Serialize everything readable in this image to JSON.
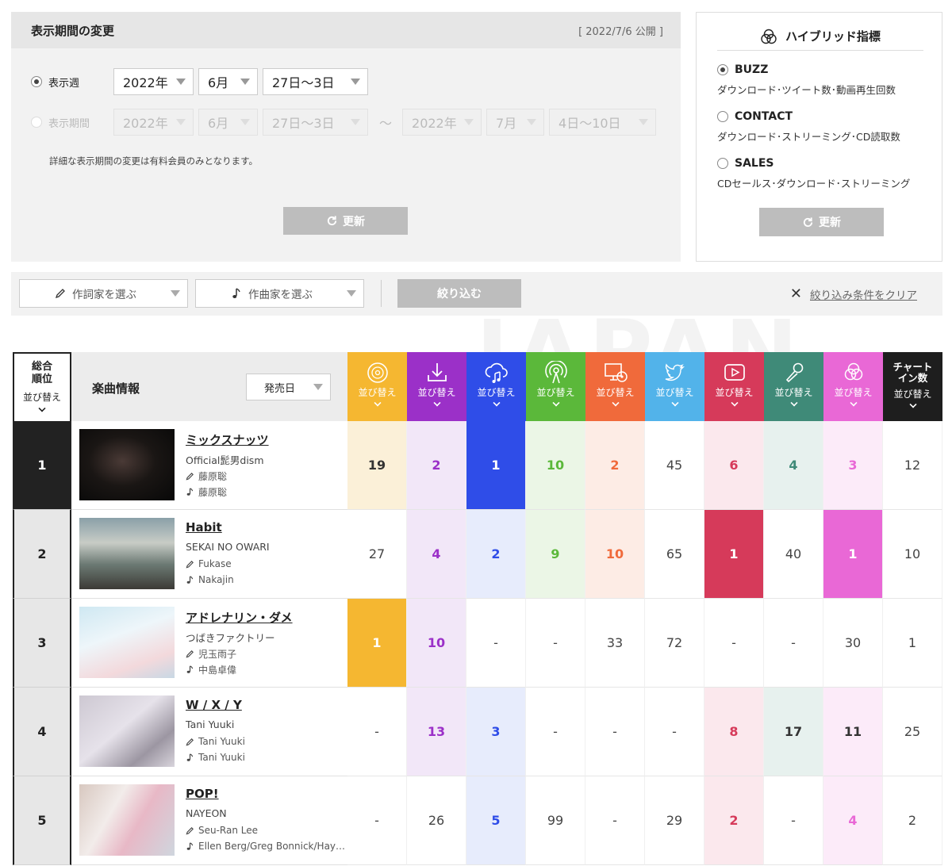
{
  "period": {
    "title": "表示期間の変更",
    "published": "[ 2022/7/6 公開 ]",
    "week_label": "表示週",
    "range_label": "表示期間",
    "week": {
      "year": "2022年",
      "month": "6月",
      "days": "27日〜3日"
    },
    "range_from": {
      "year": "2022年",
      "month": "6月",
      "days": "27日〜3日"
    },
    "range_sep": "〜",
    "range_to": {
      "year": "2022年",
      "month": "7月",
      "days": "4日〜10日"
    },
    "note": "詳細な表示期間の変更は有料会員のみとなります。",
    "update_label": "更新"
  },
  "hybrid": {
    "title": "ハイブリッド指標",
    "options": [
      {
        "name": "BUZZ",
        "desc": "ダウンロード･ツイート数･動画再生回数",
        "selected": true
      },
      {
        "name": "CONTACT",
        "desc": "ダウンロード･ストリーミング･CD読取数",
        "selected": false
      },
      {
        "name": "SALES",
        "desc": "CDセールス･ダウンロード･ストリーミング",
        "selected": false
      }
    ],
    "update_label": "更新"
  },
  "filter": {
    "lyricist_placeholder": "作詞家を選ぶ",
    "composer_placeholder": "作曲家を選ぶ",
    "narrow_label": "絞り込む",
    "clear_label": "絞り込み条件をクリア"
  },
  "watermark": "JAPAN",
  "table": {
    "rank_header": "総合\n順位",
    "sort_label": "並び替え",
    "info_header": "楽曲情報",
    "release_sort": "発売日",
    "last_header": "チャート\nイン数",
    "columns": [
      {
        "icon": "cd-icon",
        "color": "#f5b731",
        "tint": "#fbf0d8"
      },
      {
        "icon": "download-icon",
        "color": "#9b30c8",
        "tint": "#f2e7f8"
      },
      {
        "icon": "streaming-icon",
        "color": "#2f4de8",
        "tint": "#e7ecfc"
      },
      {
        "icon": "radio-icon",
        "color": "#5bb83a",
        "tint": "#ebf6e6"
      },
      {
        "icon": "pc-read-icon",
        "color": "#f06a3b",
        "tint": "#fdece5"
      },
      {
        "icon": "twitter-icon",
        "color": "#52b3ea",
        "tint": "#ffffff"
      },
      {
        "icon": "youtube-icon",
        "color": "#d63a5a",
        "tint": "#fbe8ed"
      },
      {
        "icon": "karaoke-icon",
        "color": "#3f8a78",
        "tint": "#e7f1ee"
      },
      {
        "icon": "hybrid-icon",
        "color": "#e968d6",
        "tint": "#fcebf9"
      }
    ],
    "last_color": "#1e1e1e",
    "rows": [
      {
        "rank": "1",
        "title": "ミックスナッツ",
        "artist": "Official髭男dism",
        "lyricist": "藤原聡",
        "composer": "藤原聡",
        "values": [
          "19",
          "2",
          "1",
          "10",
          "2",
          "45",
          "6",
          "4",
          "3",
          "12"
        ]
      },
      {
        "rank": "2",
        "title": "Habit",
        "artist": "SEKAI NO OWARI",
        "lyricist": "Fukase",
        "composer": "Nakajin",
        "values": [
          "27",
          "4",
          "2",
          "9",
          "10",
          "65",
          "1",
          "40",
          "1",
          "10"
        ]
      },
      {
        "rank": "3",
        "title": "アドレナリン・ダメ",
        "artist": "つばきファクトリー",
        "lyricist": "児玉雨子",
        "composer": "中島卓偉",
        "values": [
          "1",
          "10",
          "-",
          "-",
          "33",
          "72",
          "-",
          "-",
          "30",
          "1"
        ]
      },
      {
        "rank": "4",
        "title": "W / X / Y",
        "artist": "Tani Yuuki",
        "lyricist": "Tani Yuuki",
        "composer": "Tani Yuuki",
        "values": [
          "-",
          "13",
          "3",
          "-",
          "-",
          "-",
          "8",
          "17",
          "11",
          "25"
        ]
      },
      {
        "rank": "5",
        "title": "POP!",
        "artist": "NAYEON",
        "lyricist": "Seu-Ran Lee",
        "composer": "Ellen Berg/Greg Bonnick/Hay…",
        "values": [
          "-",
          "26",
          "5",
          "99",
          "-",
          "29",
          "2",
          "-",
          "4",
          "2"
        ]
      }
    ]
  }
}
